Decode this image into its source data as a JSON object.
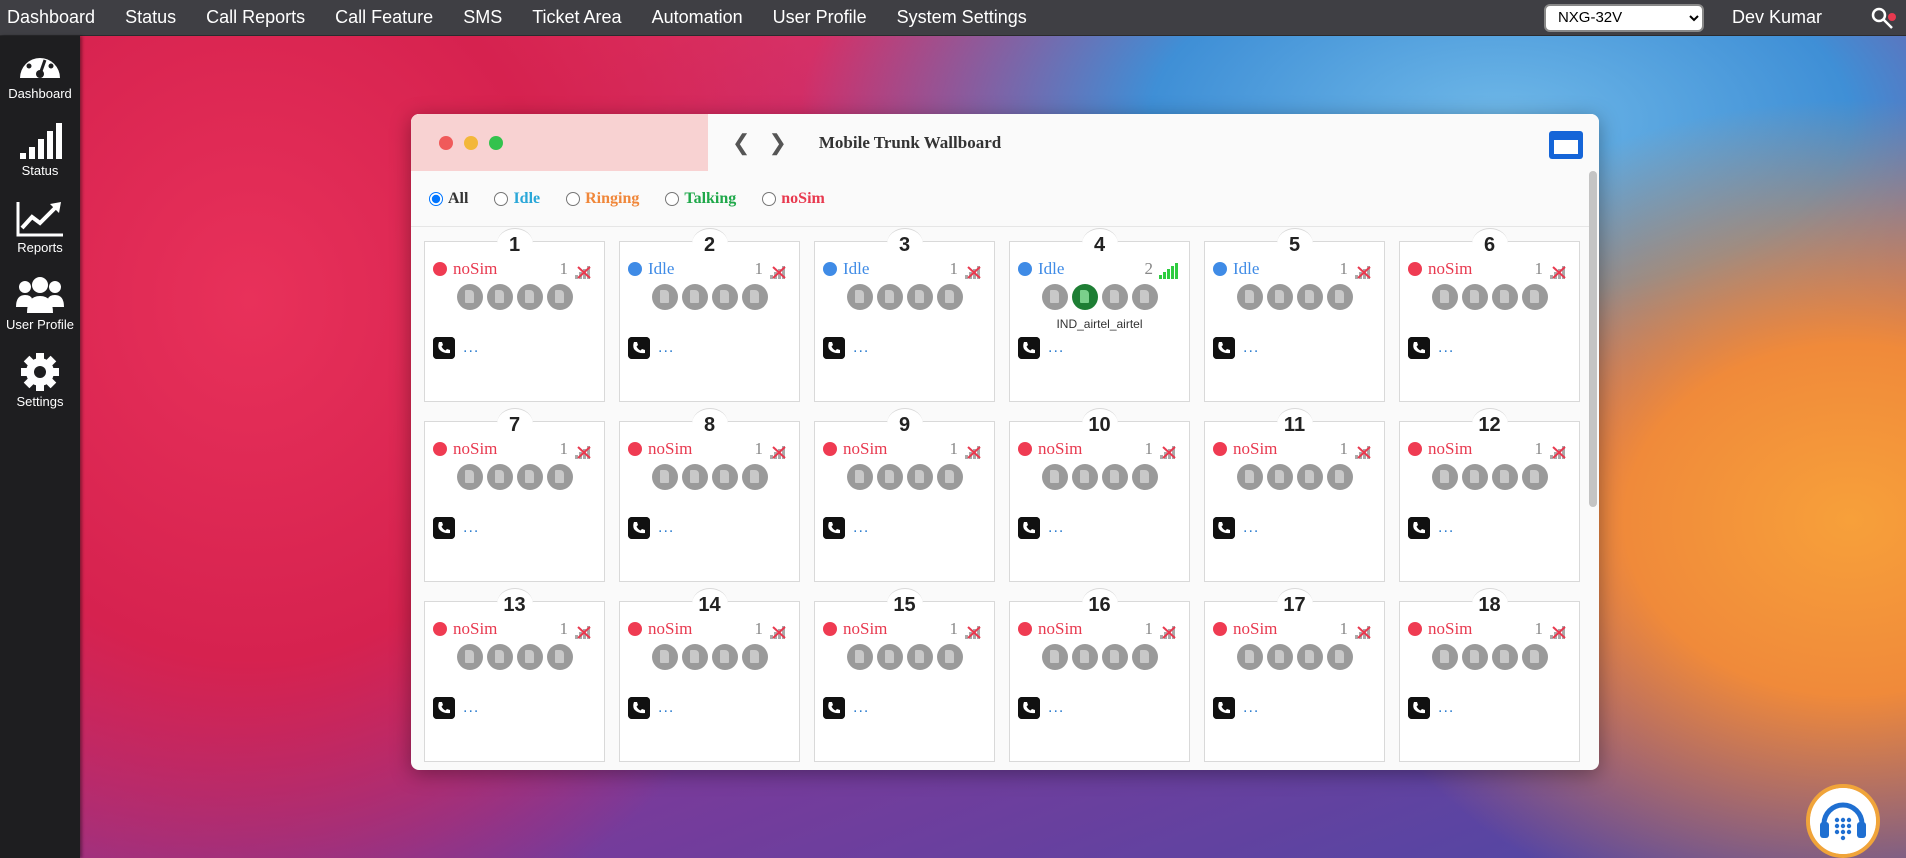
{
  "topbar": {
    "menu": [
      "Dashboard",
      "Status",
      "Call Reports",
      "Call Feature",
      "SMS",
      "Ticket Area",
      "Automation",
      "User Profile",
      "System Settings"
    ],
    "device_select": "NXG-32V",
    "user": "Dev Kumar",
    "key_icon": "key-gear-icon"
  },
  "sidebar": [
    {
      "label": "Dashboard",
      "icon": "gauge-icon"
    },
    {
      "label": "Status",
      "icon": "signal-bars-icon"
    },
    {
      "label": "Reports",
      "icon": "trend-chart-icon"
    },
    {
      "label": "User Profile",
      "icon": "users-icon"
    },
    {
      "label": "Settings",
      "icon": "gear-icon"
    }
  ],
  "window": {
    "title": "Mobile Trunk Wallboard",
    "filters": [
      {
        "label": "All",
        "color": "#333333",
        "checked": true
      },
      {
        "label": "Idle",
        "color": "#2aa7d8",
        "checked": false
      },
      {
        "label": "Ringing",
        "color": "#f0873a",
        "checked": false
      },
      {
        "label": "Talking",
        "color": "#1fa84a",
        "checked": false
      },
      {
        "label": "noSim",
        "color": "#e8394f",
        "checked": false
      }
    ]
  },
  "colors": {
    "idle": "#3f8be6",
    "idle_text": "#3f8be6",
    "nosim": "#ef3b52",
    "nosim_text": "#e8394f"
  },
  "cards": [
    {
      "num": "1",
      "status": "noSim",
      "count": "1",
      "signal": "no-signal",
      "operator": "",
      "active_sim": -1,
      "call": "..."
    },
    {
      "num": "2",
      "status": "Idle",
      "count": "1",
      "signal": "no-signal",
      "operator": "",
      "active_sim": -1,
      "call": "..."
    },
    {
      "num": "3",
      "status": "Idle",
      "count": "1",
      "signal": "no-signal",
      "operator": "",
      "active_sim": -1,
      "call": "..."
    },
    {
      "num": "4",
      "status": "Idle",
      "count": "2",
      "signal": "full-signal",
      "operator": "IND_airtel_airtel",
      "active_sim": 1,
      "call": "..."
    },
    {
      "num": "5",
      "status": "Idle",
      "count": "1",
      "signal": "no-signal",
      "operator": "",
      "active_sim": -1,
      "call": "..."
    },
    {
      "num": "6",
      "status": "noSim",
      "count": "1",
      "signal": "no-signal",
      "operator": "",
      "active_sim": -1,
      "call": "..."
    },
    {
      "num": "7",
      "status": "noSim",
      "count": "1",
      "signal": "no-signal",
      "operator": "",
      "active_sim": -1,
      "call": "..."
    },
    {
      "num": "8",
      "status": "noSim",
      "count": "1",
      "signal": "no-signal",
      "operator": "",
      "active_sim": -1,
      "call": "..."
    },
    {
      "num": "9",
      "status": "noSim",
      "count": "1",
      "signal": "no-signal",
      "operator": "",
      "active_sim": -1,
      "call": "..."
    },
    {
      "num": "10",
      "status": "noSim",
      "count": "1",
      "signal": "no-signal",
      "operator": "",
      "active_sim": -1,
      "call": "..."
    },
    {
      "num": "11",
      "status": "noSim",
      "count": "1",
      "signal": "no-signal",
      "operator": "",
      "active_sim": -1,
      "call": "..."
    },
    {
      "num": "12",
      "status": "noSim",
      "count": "1",
      "signal": "no-signal",
      "operator": "",
      "active_sim": -1,
      "call": "..."
    },
    {
      "num": "13",
      "status": "noSim",
      "count": "1",
      "signal": "no-signal",
      "operator": "",
      "active_sim": -1,
      "call": "..."
    },
    {
      "num": "14",
      "status": "noSim",
      "count": "1",
      "signal": "no-signal",
      "operator": "",
      "active_sim": -1,
      "call": "..."
    },
    {
      "num": "15",
      "status": "noSim",
      "count": "1",
      "signal": "no-signal",
      "operator": "",
      "active_sim": -1,
      "call": "..."
    },
    {
      "num": "16",
      "status": "noSim",
      "count": "1",
      "signal": "no-signal",
      "operator": "",
      "active_sim": -1,
      "call": "..."
    },
    {
      "num": "17",
      "status": "noSim",
      "count": "1",
      "signal": "no-signal",
      "operator": "",
      "active_sim": -1,
      "call": "..."
    },
    {
      "num": "18",
      "status": "noSim",
      "count": "1",
      "signal": "no-signal",
      "operator": "",
      "active_sim": -1,
      "call": "..."
    }
  ],
  "support_icon": "headset-dialpad-icon"
}
